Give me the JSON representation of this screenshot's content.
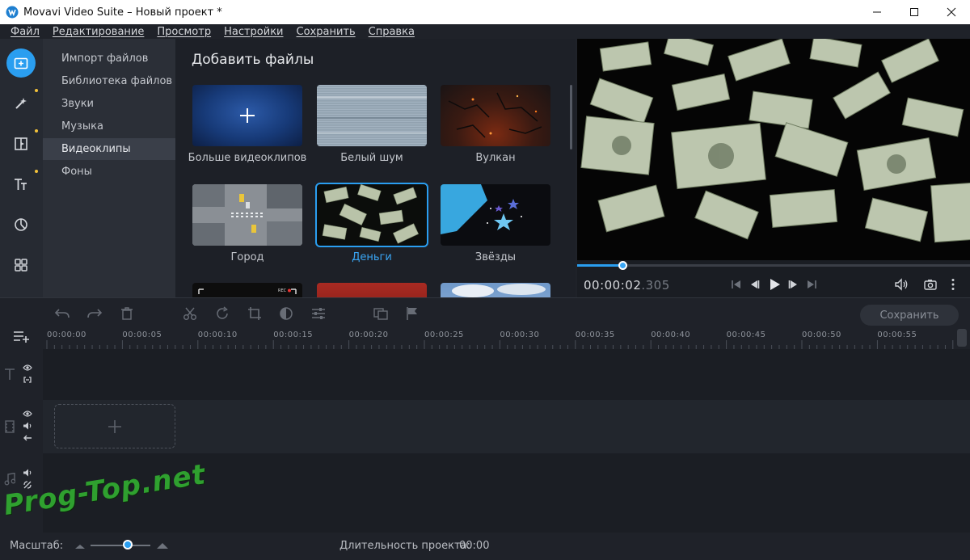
{
  "window": {
    "title": "Movavi Video Suite – Новый проект *"
  },
  "menu": [
    "Файл",
    "Редактирование",
    "Просмотр",
    "Настройки",
    "Сохранить",
    "Справка"
  ],
  "left_tools": [
    {
      "icon": "import-icon",
      "active": true,
      "dot": false
    },
    {
      "icon": "magic-wand-icon",
      "active": false,
      "dot": true
    },
    {
      "icon": "transitions-icon",
      "active": false,
      "dot": true
    },
    {
      "icon": "titles-icon",
      "active": false,
      "dot": true
    },
    {
      "icon": "filters-icon",
      "active": false,
      "dot": false
    },
    {
      "icon": "more-tools-icon",
      "active": false,
      "dot": false
    }
  ],
  "categories": [
    "Импорт файлов",
    "Библиотека файлов",
    "Звуки",
    "Музыка",
    "Видеоклипы",
    "Фоны"
  ],
  "selected_category": 4,
  "library": {
    "title": "Добавить файлы",
    "tiles": [
      "Больше видеоклипов",
      "Белый шум",
      "Вулкан",
      "Город",
      "Деньги",
      "Звёзды"
    ],
    "selected_tile": 4
  },
  "preview": {
    "time_main": "00:00:02",
    "time_ms": ".305",
    "progress": 0.117
  },
  "editbar": {
    "save_label": "Сохранить"
  },
  "ruler": [
    "00:00:00",
    "00:00:05",
    "00:00:10",
    "00:00:15",
    "00:00:20",
    "00:00:25",
    "00:00:30",
    "00:00:35",
    "00:00:40",
    "00:00:45",
    "00:00:50",
    "00:00:55"
  ],
  "status": {
    "scale_label": "Масштаб:",
    "scale_value": 0.62,
    "duration_label": "Длительность проекта:",
    "duration_value": "00:00"
  },
  "watermark": "Prog-Top.net",
  "colors": {
    "accent": "#2a9ef0",
    "dot": "#f2c13a",
    "watermark": "#2fa02f"
  }
}
